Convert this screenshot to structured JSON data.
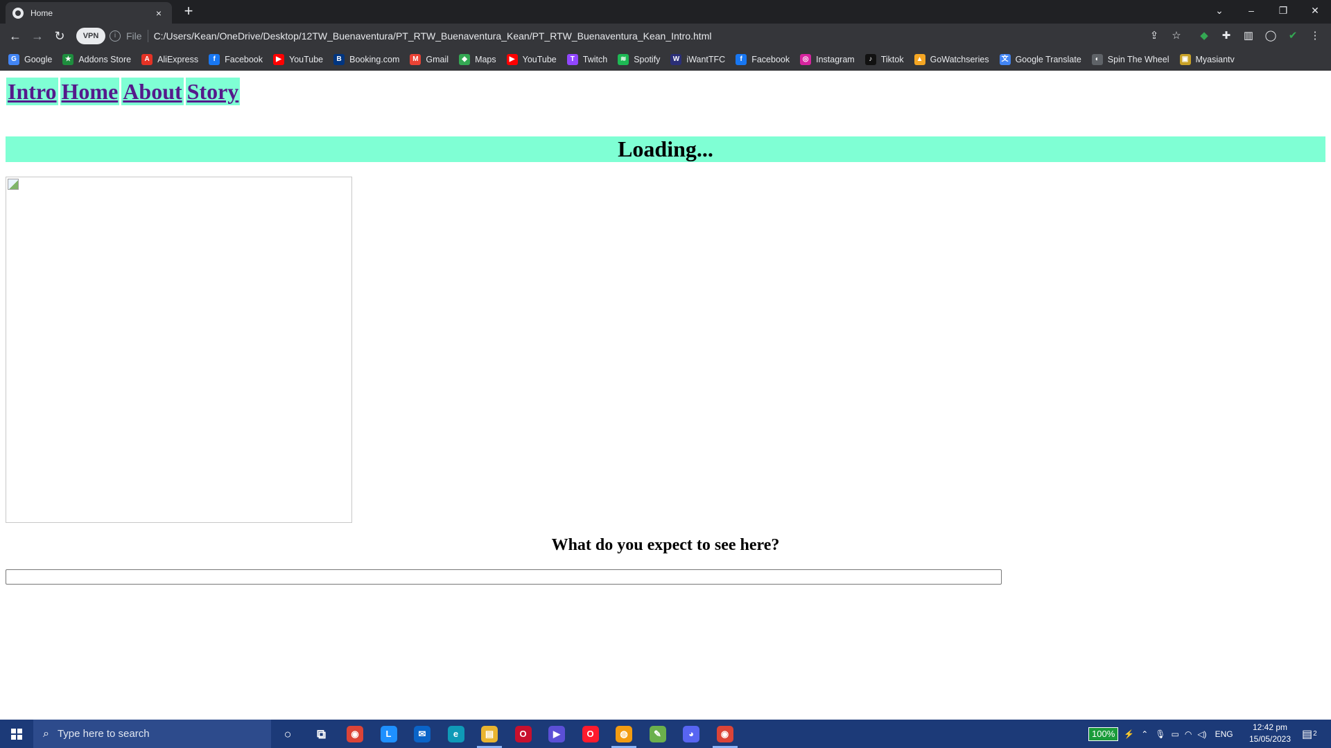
{
  "browser": {
    "tab_title": "Home",
    "tab_close": "×",
    "new_tab": "+",
    "window_controls": {
      "tab_search": "⌄",
      "minimize": "–",
      "restore": "❐",
      "close": "✕"
    },
    "nav": {
      "back": "←",
      "forward": "→",
      "reload": "↻"
    },
    "vpn_label": "VPN",
    "scheme_label": "File",
    "url": "C:/Users/Kean/OneDrive/Desktop/12TW_Buenaventura/PT_RTW_Buenaventura_Kean/PT_RTW_Buenaventura_Kean_Intro.html",
    "bookmarks": [
      {
        "label": "Google",
        "icon": "google-icon",
        "glyph": "G",
        "color": "#4285f4"
      },
      {
        "label": "Addons Store",
        "icon": "addons-icon",
        "glyph": "★",
        "color": "#1e8e3e"
      },
      {
        "label": "AliExpress",
        "icon": "aliexpress-icon",
        "glyph": "A",
        "color": "#e43225"
      },
      {
        "label": "Facebook",
        "icon": "facebook-icon",
        "glyph": "f",
        "color": "#1877f2"
      },
      {
        "label": "YouTube",
        "icon": "youtube-icon",
        "glyph": "▶",
        "color": "#ff0000"
      },
      {
        "label": "Booking.com",
        "icon": "booking-icon",
        "glyph": "B",
        "color": "#003580"
      },
      {
        "label": "Gmail",
        "icon": "gmail-icon",
        "glyph": "M",
        "color": "#ea4335"
      },
      {
        "label": "Maps",
        "icon": "maps-icon",
        "glyph": "◆",
        "color": "#34a853"
      },
      {
        "label": "YouTube",
        "icon": "youtube-icon",
        "glyph": "▶",
        "color": "#ff0000"
      },
      {
        "label": "Twitch",
        "icon": "twitch-icon",
        "glyph": "T",
        "color": "#9146ff"
      },
      {
        "label": "Spotify",
        "icon": "spotify-icon",
        "glyph": "≋",
        "color": "#1db954"
      },
      {
        "label": "iWantTFC",
        "icon": "iwanttfc-icon",
        "glyph": "W",
        "color": "#2b2f77"
      },
      {
        "label": "Facebook",
        "icon": "facebook-icon",
        "glyph": "f",
        "color": "#1877f2"
      },
      {
        "label": "Instagram",
        "icon": "instagram-icon",
        "glyph": "◎",
        "color": "#d6249f"
      },
      {
        "label": "Tiktok",
        "icon": "tiktok-icon",
        "glyph": "♪",
        "color": "#111111"
      },
      {
        "label": "GoWatchseries",
        "icon": "gowatchseries-icon",
        "glyph": "▲",
        "color": "#f5a623"
      },
      {
        "label": "Google Translate",
        "icon": "translate-icon",
        "glyph": "文",
        "color": "#4285f4"
      },
      {
        "label": "Spin The Wheel",
        "icon": "wheel-icon",
        "glyph": "◐",
        "color": "#5f6368"
      },
      {
        "label": "Myasiantv",
        "icon": "myasiantv-icon",
        "glyph": "▣",
        "color": "#c9a227"
      }
    ]
  },
  "page": {
    "nav_links": [
      "Intro",
      "Home",
      "About",
      "Story"
    ],
    "loading_text": "Loading...",
    "question": "What do you expect to see here?",
    "answer_value": ""
  },
  "taskbar": {
    "search_placeholder": "Type here to search",
    "apps": [
      {
        "name": "cortana-icon",
        "glyph": "○",
        "color": "transparent",
        "active": false
      },
      {
        "name": "task-view-icon",
        "glyph": "⧉",
        "color": "transparent",
        "active": false
      },
      {
        "name": "chrome-icon",
        "glyph": "◉",
        "color": "#db4437",
        "active": false
      },
      {
        "name": "l-app-icon",
        "glyph": "L",
        "color": "#1e90ff",
        "active": false
      },
      {
        "name": "mail-icon",
        "glyph": "✉",
        "color": "#0a64c8",
        "active": false
      },
      {
        "name": "edge-icon",
        "glyph": "e",
        "color": "#0f9ab7",
        "active": false
      },
      {
        "name": "file-explorer-icon",
        "glyph": "▤",
        "color": "#e8b430",
        "active": true
      },
      {
        "name": "opera-gx-icon",
        "glyph": "O",
        "color": "#c8102e",
        "active": false
      },
      {
        "name": "video-editor-icon",
        "glyph": "▶",
        "color": "#5b4fd6",
        "active": false
      },
      {
        "name": "opera-icon",
        "glyph": "O",
        "color": "#ff1b2d",
        "active": false
      },
      {
        "name": "vpn-browser-icon",
        "glyph": "◍",
        "color": "#f39c12",
        "active": true
      },
      {
        "name": "notepad-icon",
        "glyph": "✎",
        "color": "#6bb04c",
        "active": false
      },
      {
        "name": "discord-icon",
        "glyph": "◕",
        "color": "#5865f2",
        "active": false
      },
      {
        "name": "chrome-active-icon",
        "glyph": "◉",
        "color": "#db4437",
        "active": true
      }
    ],
    "battery_percent": "100%",
    "language": "ENG",
    "time": "12:42 pm",
    "date": "15/05/2023",
    "notifications": "2"
  }
}
